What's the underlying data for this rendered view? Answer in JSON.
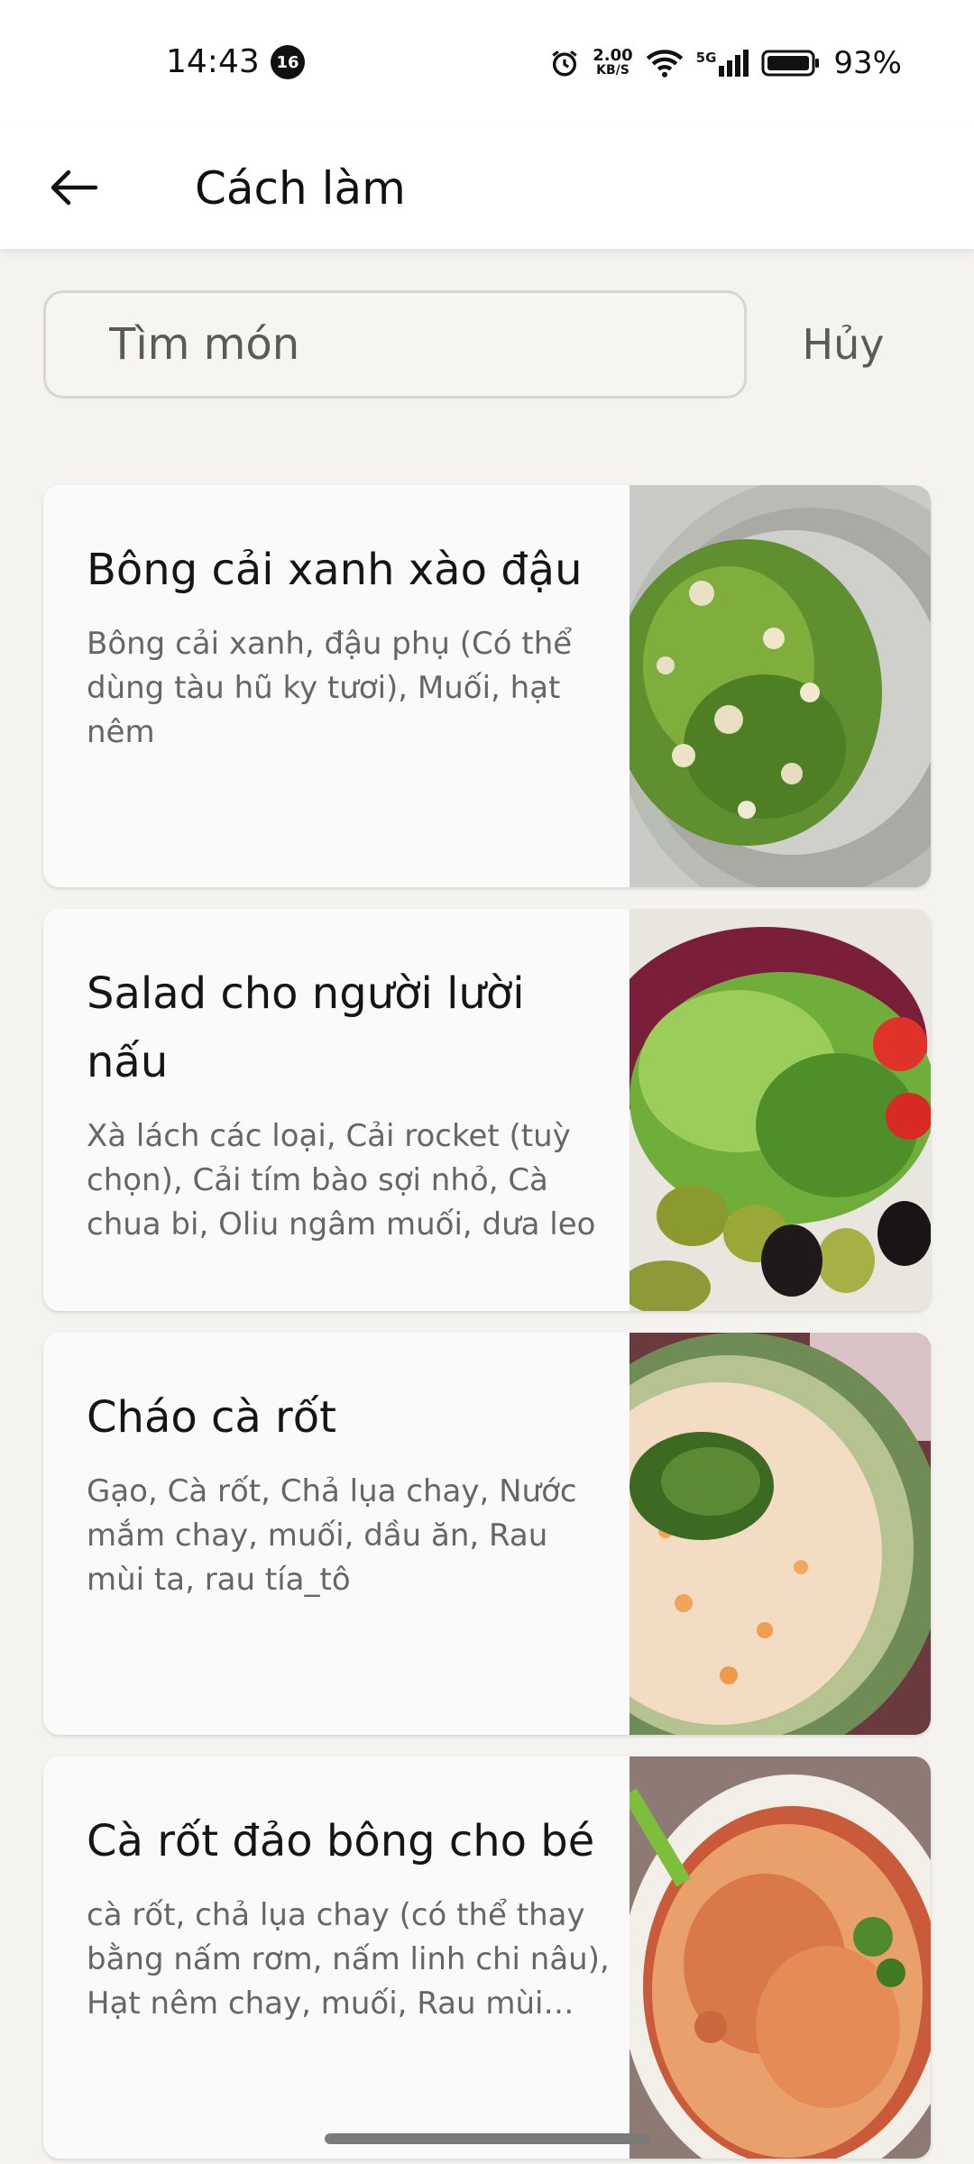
{
  "status_bar": {
    "time": "14:43",
    "notification_count": "16",
    "speed_value": "2.00",
    "speed_unit": "KB/S",
    "network": "5G",
    "battery": "93%"
  },
  "header": {
    "title": "Cách làm",
    "back_icon": "arrow-left-icon"
  },
  "search": {
    "placeholder": "Tìm món",
    "cancel_label": "Hủy"
  },
  "recipes": [
    {
      "title": "Bông cải xanh xào đậu",
      "ingredients": "Bông cải xanh, đậu phụ (Có thể dùng tàu hũ ky tươi), Muối, hạt nêm",
      "image": "broccoli-tofu-photo"
    },
    {
      "title": "Salad cho người lười nấu",
      "ingredients": "Xà lách các loại, Cải rocket (tuỳ chọn), Cải tím bào sợi nhỏ, Cà chua bi, Oliu ngâm muối, dưa leo",
      "image": "salad-photo"
    },
    {
      "title": "Cháo cà rốt",
      "ingredients": "Gạo, Cà rốt, Chả lụa chay, Nước mắm chay, muối, dầu ăn, Rau mùi ta, rau tía_tô",
      "image": "carrot-porridge-photo"
    },
    {
      "title": "Cà rốt đảo bông cho bé",
      "ingredients": "cà rốt, chả lụa chay (có thể thay bằng nấm rơm, nấm linh chi nâu), Hạt nêm chay, muối, Rau mùi (k...",
      "image": "carrot-stirfry-photo"
    }
  ]
}
